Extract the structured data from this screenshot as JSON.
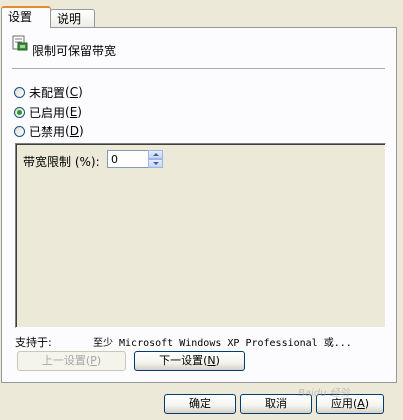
{
  "tabs": [
    {
      "label": "设置",
      "active": true
    },
    {
      "label": "说明",
      "active": false
    }
  ],
  "policy": {
    "icon": "policy-setting-icon",
    "title": "限制可保留带宽"
  },
  "state_options": [
    {
      "label": "未配置",
      "mnemonic": "C",
      "checked": false
    },
    {
      "label": "已启用",
      "mnemonic": "E",
      "checked": true
    },
    {
      "label": "已禁用",
      "mnemonic": "D",
      "checked": false
    }
  ],
  "options": {
    "bandwidth_label": "带宽限制 (%):",
    "bandwidth_value": "0"
  },
  "supported": {
    "label": "支持于:",
    "value": "至少 Microsoft Windows XP Professional 或..."
  },
  "nav_buttons": {
    "prev": {
      "label": "上一设置",
      "mnemonic": "P",
      "enabled": false
    },
    "next": {
      "label": "下一设置",
      "mnemonic": "N",
      "enabled": true
    }
  },
  "dialog_buttons": {
    "ok": "确定",
    "cancel": "取消",
    "apply": {
      "label": "应用",
      "mnemonic": "A"
    }
  },
  "watermark": "Baidu 经验",
  "colors": {
    "dialog_bg": "#ece9d8",
    "tab_accent": "#e68b2c",
    "radio_dot": "#21a121",
    "button_border": "#003c74"
  }
}
